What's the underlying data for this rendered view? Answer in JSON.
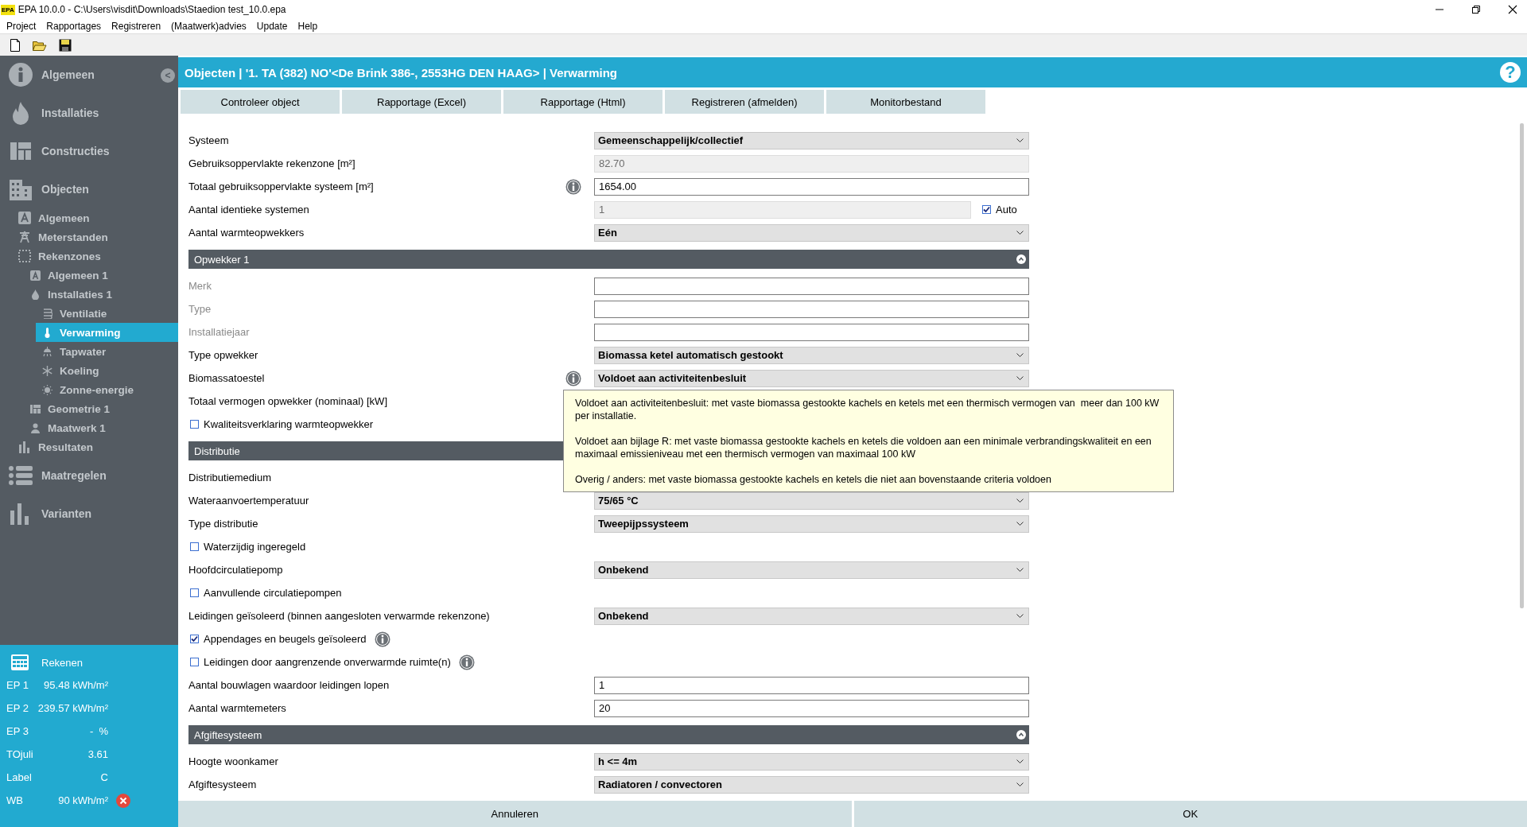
{
  "window": {
    "app_badge": "EPA",
    "title": "EPA 10.0.0 - C:\\Users\\visdit\\Downloads\\Staedion test_10.0.epa"
  },
  "menu": [
    "Project",
    "Rapportages",
    "Registreren",
    "(Maatwerk)advies",
    "Update",
    "Help"
  ],
  "sidebar": {
    "collapse_glyph": "<",
    "items": [
      {
        "label": "Algemeen",
        "selected": false
      },
      {
        "label": "Installaties",
        "selected": false
      },
      {
        "label": "Constructies",
        "selected": false
      },
      {
        "label": "Objecten",
        "selected": false,
        "children": [
          {
            "label": "Algemeen",
            "selected": false
          },
          {
            "label": "Meterstanden",
            "selected": false
          },
          {
            "label": "Rekenzones",
            "selected": false,
            "children": [
              {
                "label": "Algemeen 1",
                "selected": false
              },
              {
                "label": "Installaties 1",
                "selected": false,
                "children": [
                  {
                    "label": "Ventilatie",
                    "selected": false
                  },
                  {
                    "label": "Verwarming",
                    "selected": true
                  },
                  {
                    "label": "Tapwater",
                    "selected": false
                  },
                  {
                    "label": "Koeling",
                    "selected": false
                  },
                  {
                    "label": "Zonne-energie",
                    "selected": false
                  }
                ]
              },
              {
                "label": "Geometrie 1",
                "selected": false
              },
              {
                "label": "Maatwerk 1",
                "selected": false
              }
            ]
          },
          {
            "label": "Resultaten",
            "selected": false
          }
        ]
      },
      {
        "label": "Maatregelen",
        "selected": false
      },
      {
        "label": "Varianten",
        "selected": false
      }
    ]
  },
  "results": {
    "title": "Rekenen",
    "rows": [
      {
        "label": "EP 1",
        "value": "95.48 kWh/m²",
        "error": false
      },
      {
        "label": "EP 2",
        "value": "239.57 kWh/m²",
        "error": false
      },
      {
        "label": "EP 3",
        "value": "-  %",
        "error": false
      },
      {
        "label": "TOjuli",
        "value": "3.61",
        "error": false
      },
      {
        "label": "Label",
        "value": "C",
        "error": false
      },
      {
        "label": "WB",
        "value": "90 kWh/m²",
        "error": true
      }
    ]
  },
  "header": {
    "title": "Objecten | '1. TA (382) NO'<De Brink 386-, 2553HG DEN HAAG> | Verwarming",
    "help_glyph": "?"
  },
  "actions": [
    "Controleer object",
    "Rapportage (Excel)",
    "Rapportage (Html)",
    "Registreren (afmelden)",
    "Monitorbestand"
  ],
  "form": {
    "sections": [
      {
        "rows": [
          {
            "kind": "select",
            "label": "Systeem",
            "value": "Gemeenschappelijk/collectief",
            "dimmed": false
          },
          {
            "kind": "text",
            "label": "Gebruiksoppervlakte rekenzone [m²]",
            "value": "82.70",
            "readonly": true,
            "dimmed": false
          },
          {
            "kind": "text",
            "label": "Totaal gebruiksoppervlakte systeem [m²]",
            "value": "1654.00",
            "readonly": false,
            "dimmed": false,
            "info": true
          },
          {
            "kind": "text",
            "label": "Aantal identieke systemen",
            "value": "1",
            "readonly": true,
            "dimmed": false,
            "auto": {
              "label": "Auto",
              "checked": true
            }
          },
          {
            "kind": "select",
            "label": "Aantal warmteopwekkers",
            "value": "Eén",
            "dimmed": false
          }
        ]
      },
      {
        "title": "Opwekker 1",
        "expanded": true,
        "rows": [
          {
            "kind": "text",
            "label": "Merk",
            "readonly": false,
            "dimmed": true
          },
          {
            "kind": "text",
            "label": "Type",
            "readonly": false,
            "dimmed": true
          },
          {
            "kind": "text",
            "label": "Installatiejaar",
            "readonly": false,
            "dimmed": true
          },
          {
            "kind": "select",
            "label": "Type opwekker",
            "value": "Biomassa ketel automatisch gestookt",
            "dimmed": false
          },
          {
            "kind": "select",
            "label": "Biomassatoestel",
            "value": "Voldoet aan activiteitenbesluit",
            "dimmed": false,
            "info": true
          },
          {
            "kind": "covered",
            "label": "Totaal vermogen opwekker (nominaal) [kW]",
            "dimmed": false
          },
          {
            "kind": "checkbox",
            "label": "Kwaliteitsverklaring warmteopwekker",
            "checked": false
          }
        ]
      },
      {
        "title": "Distributie",
        "rows": [
          {
            "kind": "covered",
            "label": "Distributiemedium",
            "dimmed": false
          },
          {
            "kind": "select",
            "label": "Wateraanvoertemperatuur",
            "value": "75/65 °C",
            "dimmed": false
          },
          {
            "kind": "select",
            "label": "Type distributie",
            "value": "Tweepijpssysteem",
            "dimmed": false
          },
          {
            "kind": "checkbox",
            "label": "Waterzijdig ingeregeld",
            "checked": false
          },
          {
            "kind": "select",
            "label": "Hoofdcirculatiepomp",
            "value": "Onbekend",
            "dimmed": false
          },
          {
            "kind": "checkbox",
            "label": "Aanvullende circulatiepompen",
            "checked": false
          },
          {
            "kind": "select",
            "label": "Leidingen geïsoleerd (binnen aangesloten verwarmde rekenzone)",
            "value": "Onbekend",
            "dimmed": false
          },
          {
            "kind": "checkbox",
            "label": "Appendages en beugels geïsoleerd",
            "checked": true,
            "info": true
          },
          {
            "kind": "checkbox",
            "label": "Leidingen door aangrenzende onverwarmde ruimte(n)",
            "checked": false,
            "info": true
          },
          {
            "kind": "text",
            "label": "Aantal bouwlagen waardoor leidingen lopen",
            "value": "1",
            "readonly": false,
            "dimmed": false
          },
          {
            "kind": "text",
            "label": "Aantal warmtemeters",
            "value": "20",
            "readonly": false,
            "dimmed": false
          }
        ]
      },
      {
        "title": "Afgiftesysteem",
        "expanded": true,
        "rows": [
          {
            "kind": "select",
            "label": "Hoogte woonkamer",
            "value": "h <= 4m",
            "dimmed": false
          },
          {
            "kind": "select",
            "label": "Afgiftesysteem",
            "value": "Radiatoren / convectoren",
            "dimmed": false
          }
        ]
      }
    ]
  },
  "tooltip": {
    "paragraphs": [
      "Voldoet aan activiteitenbesluit: met vaste biomassa gestookte kachels en ketels met een thermisch vermogen van  meer dan 100 kW per installatie.",
      "Voldoet aan bijlage R: met vaste biomassa gestookte kachels en ketels die voldoen aan een minimale verbrandingskwaliteit en een maximaal emissieniveau met een thermisch vermogen van maximaal 100 kW",
      "Overig / anders: met vaste biomassa gestookte kachels en ketels die niet aan bovenstaande criteria voldoen"
    ]
  },
  "footer_buttons": [
    "Annuleren",
    "OK"
  ]
}
